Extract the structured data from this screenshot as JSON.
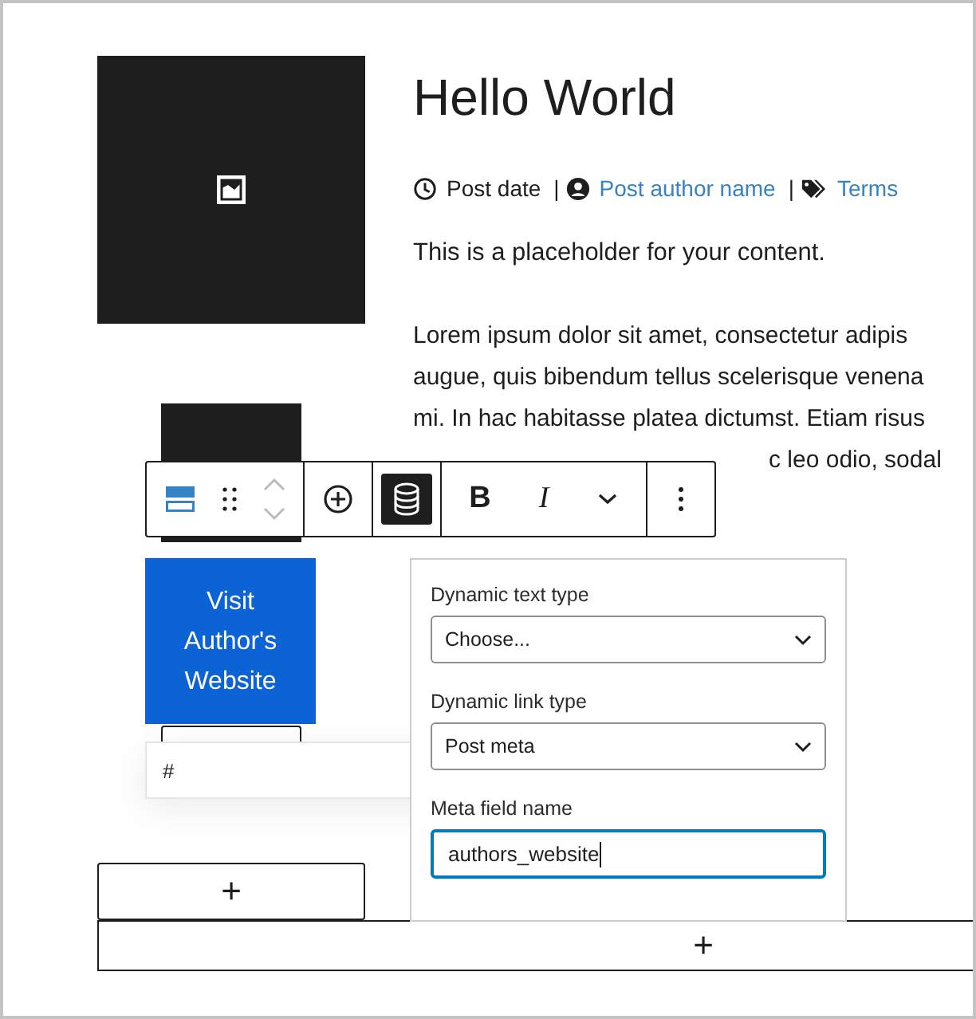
{
  "post": {
    "title": "Hello World",
    "meta": [
      {
        "kind": "date",
        "text": "Post date"
      },
      {
        "kind": "separator",
        "text": "|"
      },
      {
        "kind": "author",
        "text": "Post author name"
      },
      {
        "kind": "separator",
        "text": "|"
      },
      {
        "kind": "terms",
        "text": "Terms"
      }
    ],
    "intro": "This is a placeholder for your content.",
    "paragraph_lines": [
      "Lorem ipsum dolor sit amet, consectetur adipis",
      "augue, quis bibendum tellus scelerisque venena",
      "mi. In hac habitasse platea dictumst. Etiam risus"
    ],
    "covered_line": "c leo odio, sodal"
  },
  "toolbar": {
    "groups": [
      {
        "buttons": [
          {
            "kind": "block-type",
            "selected": false
          },
          {
            "kind": "drag",
            "selected": false
          },
          {
            "kind": "mover",
            "selected": false
          }
        ]
      },
      {
        "buttons": [
          {
            "kind": "insert",
            "selected": false
          }
        ]
      },
      {
        "buttons": [
          {
            "kind": "dynamic",
            "selected": true
          }
        ]
      },
      {
        "buttons": [
          {
            "kind": "bold",
            "text": "B",
            "selected": false
          },
          {
            "kind": "italic",
            "text": "I",
            "selected": false
          },
          {
            "kind": "more",
            "selected": false
          }
        ]
      },
      {
        "buttons": [
          {
            "kind": "options",
            "selected": false
          }
        ]
      }
    ]
  },
  "button": {
    "label": "Visit Author's Website"
  },
  "link_popover": {
    "url": "#"
  },
  "dynamic_panel": {
    "fields": [
      {
        "kind": "select",
        "label": "Dynamic text type",
        "value": "Choose...",
        "focused": false
      },
      {
        "kind": "select",
        "label": "Dynamic link type",
        "value": "Post meta",
        "focused": false
      },
      {
        "kind": "text",
        "label": "Meta field name",
        "value": "authors_website",
        "focused": true
      }
    ]
  },
  "appenders": [
    {
      "kind": "block",
      "text": "+"
    },
    {
      "kind": "section",
      "text": "+"
    }
  ]
}
